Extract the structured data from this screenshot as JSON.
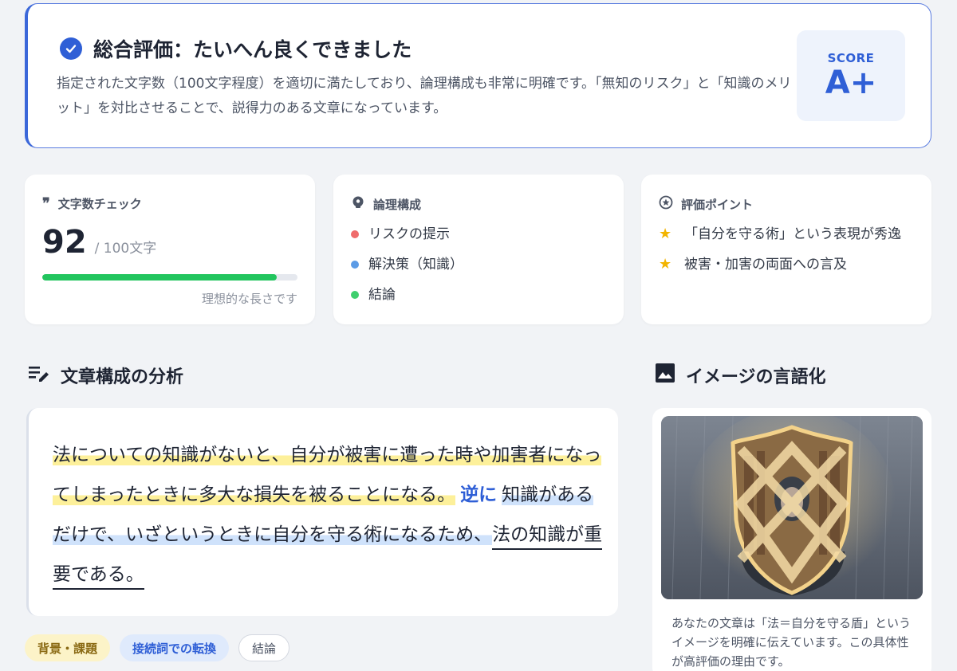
{
  "summary": {
    "title": "総合評価：たいへん良くできました",
    "text": "指定された文字数（100文字程度）を適切に満たしており、論理構成も非常に明確です。「無知のリスク」と「知識のメリット」を対比させることで、説得力のある文章になっています。",
    "score_label": "SCORE",
    "score_value": "A+"
  },
  "char_count": {
    "title": "文字数チェック",
    "value": "92",
    "total": "/ 100文字",
    "progress": 0.92,
    "note": "理想的な長さです"
  },
  "logic": {
    "title": "論理構成",
    "items": [
      {
        "label": "リスクの提示",
        "color": "#ef6b6b"
      },
      {
        "label": "解決策（知識）",
        "color": "#5b9be6"
      },
      {
        "label": "結論",
        "color": "#3fcf6e"
      }
    ]
  },
  "points": {
    "title": "評価ポイント",
    "items": [
      {
        "label": "「自分を守る術」という表現が秀逸"
      },
      {
        "label": "被害・加害の両面への言及"
      }
    ]
  },
  "analysis": {
    "title": "文章構成の分析",
    "seg1": "法についての知識がないと、自分が被害に遭った時や加害者になってしまったときに多大な損失を被ることになる。",
    "conj": "逆に",
    "seg2": "知識があるだけで、いざというときに自分を守る術になるため、",
    "seg3": "法の知識が重要である。",
    "tags": [
      "背景・課題",
      "接続詞での転換",
      "結論"
    ]
  },
  "image_section": {
    "title": "イメージの言語化",
    "caption": "あなたの文章は「法＝自分を守る盾」というイメージを明確に伝えています。この具体性が高評価の理由です。"
  }
}
